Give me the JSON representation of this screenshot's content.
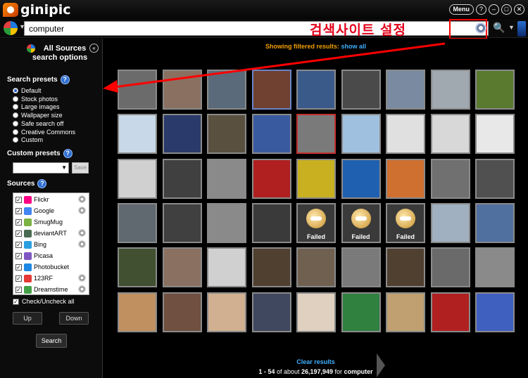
{
  "app": {
    "brand": "ginipic"
  },
  "window": {
    "menu_label": "Menu",
    "help_glyph": "?",
    "min_glyph": "–",
    "max_glyph": "□",
    "close_glyph": "✕"
  },
  "search": {
    "query": "computer",
    "annotation": "검색사이트 설정"
  },
  "sidebar": {
    "title_line1": "All Sources",
    "title_line2": "search options",
    "collapse_glyph": "«",
    "presets_title": "Search presets",
    "presets": [
      {
        "label": "Default",
        "selected": true
      },
      {
        "label": "Stock photos",
        "selected": false
      },
      {
        "label": "Large images",
        "selected": false
      },
      {
        "label": "Wallpaper size",
        "selected": false
      },
      {
        "label": "Safe search off",
        "selected": false
      },
      {
        "label": "Creative Commons",
        "selected": false
      },
      {
        "label": "Custom",
        "selected": false
      }
    ],
    "custom_presets_title": "Custom presets",
    "save_label": "Save",
    "sources_title": "Sources",
    "sources": [
      {
        "label": "Flickr",
        "color": "#ff0084",
        "gear": true
      },
      {
        "label": "Google",
        "color": "#4285f4",
        "gear": true
      },
      {
        "label": "SmugMug",
        "color": "#7cb342",
        "gear": false
      },
      {
        "label": "deviantART",
        "color": "#4a6b52",
        "gear": true
      },
      {
        "label": "Bing",
        "color": "#2aa0e0",
        "gear": true
      },
      {
        "label": "Picasa",
        "color": "#7e57c2",
        "gear": false
      },
      {
        "label": "Photobucket",
        "color": "#1e88e5",
        "gear": false
      },
      {
        "label": "123RF",
        "color": "#e53935",
        "gear": true
      },
      {
        "label": "Dreamstime",
        "color": "#43a047",
        "gear": true
      }
    ],
    "check_all_label": "Check/Uncheck all",
    "up_label": "Up",
    "down_label": "Down",
    "search_button": "Search"
  },
  "results": {
    "filter_label": "Showing filtered results:",
    "show_all": "show all",
    "clear_results": "Clear results",
    "count_prefix": "1 - 54",
    "count_mid": "of about",
    "total": "26,197,949",
    "count_for": "for",
    "query": "computer",
    "failed_label": "Failed"
  }
}
